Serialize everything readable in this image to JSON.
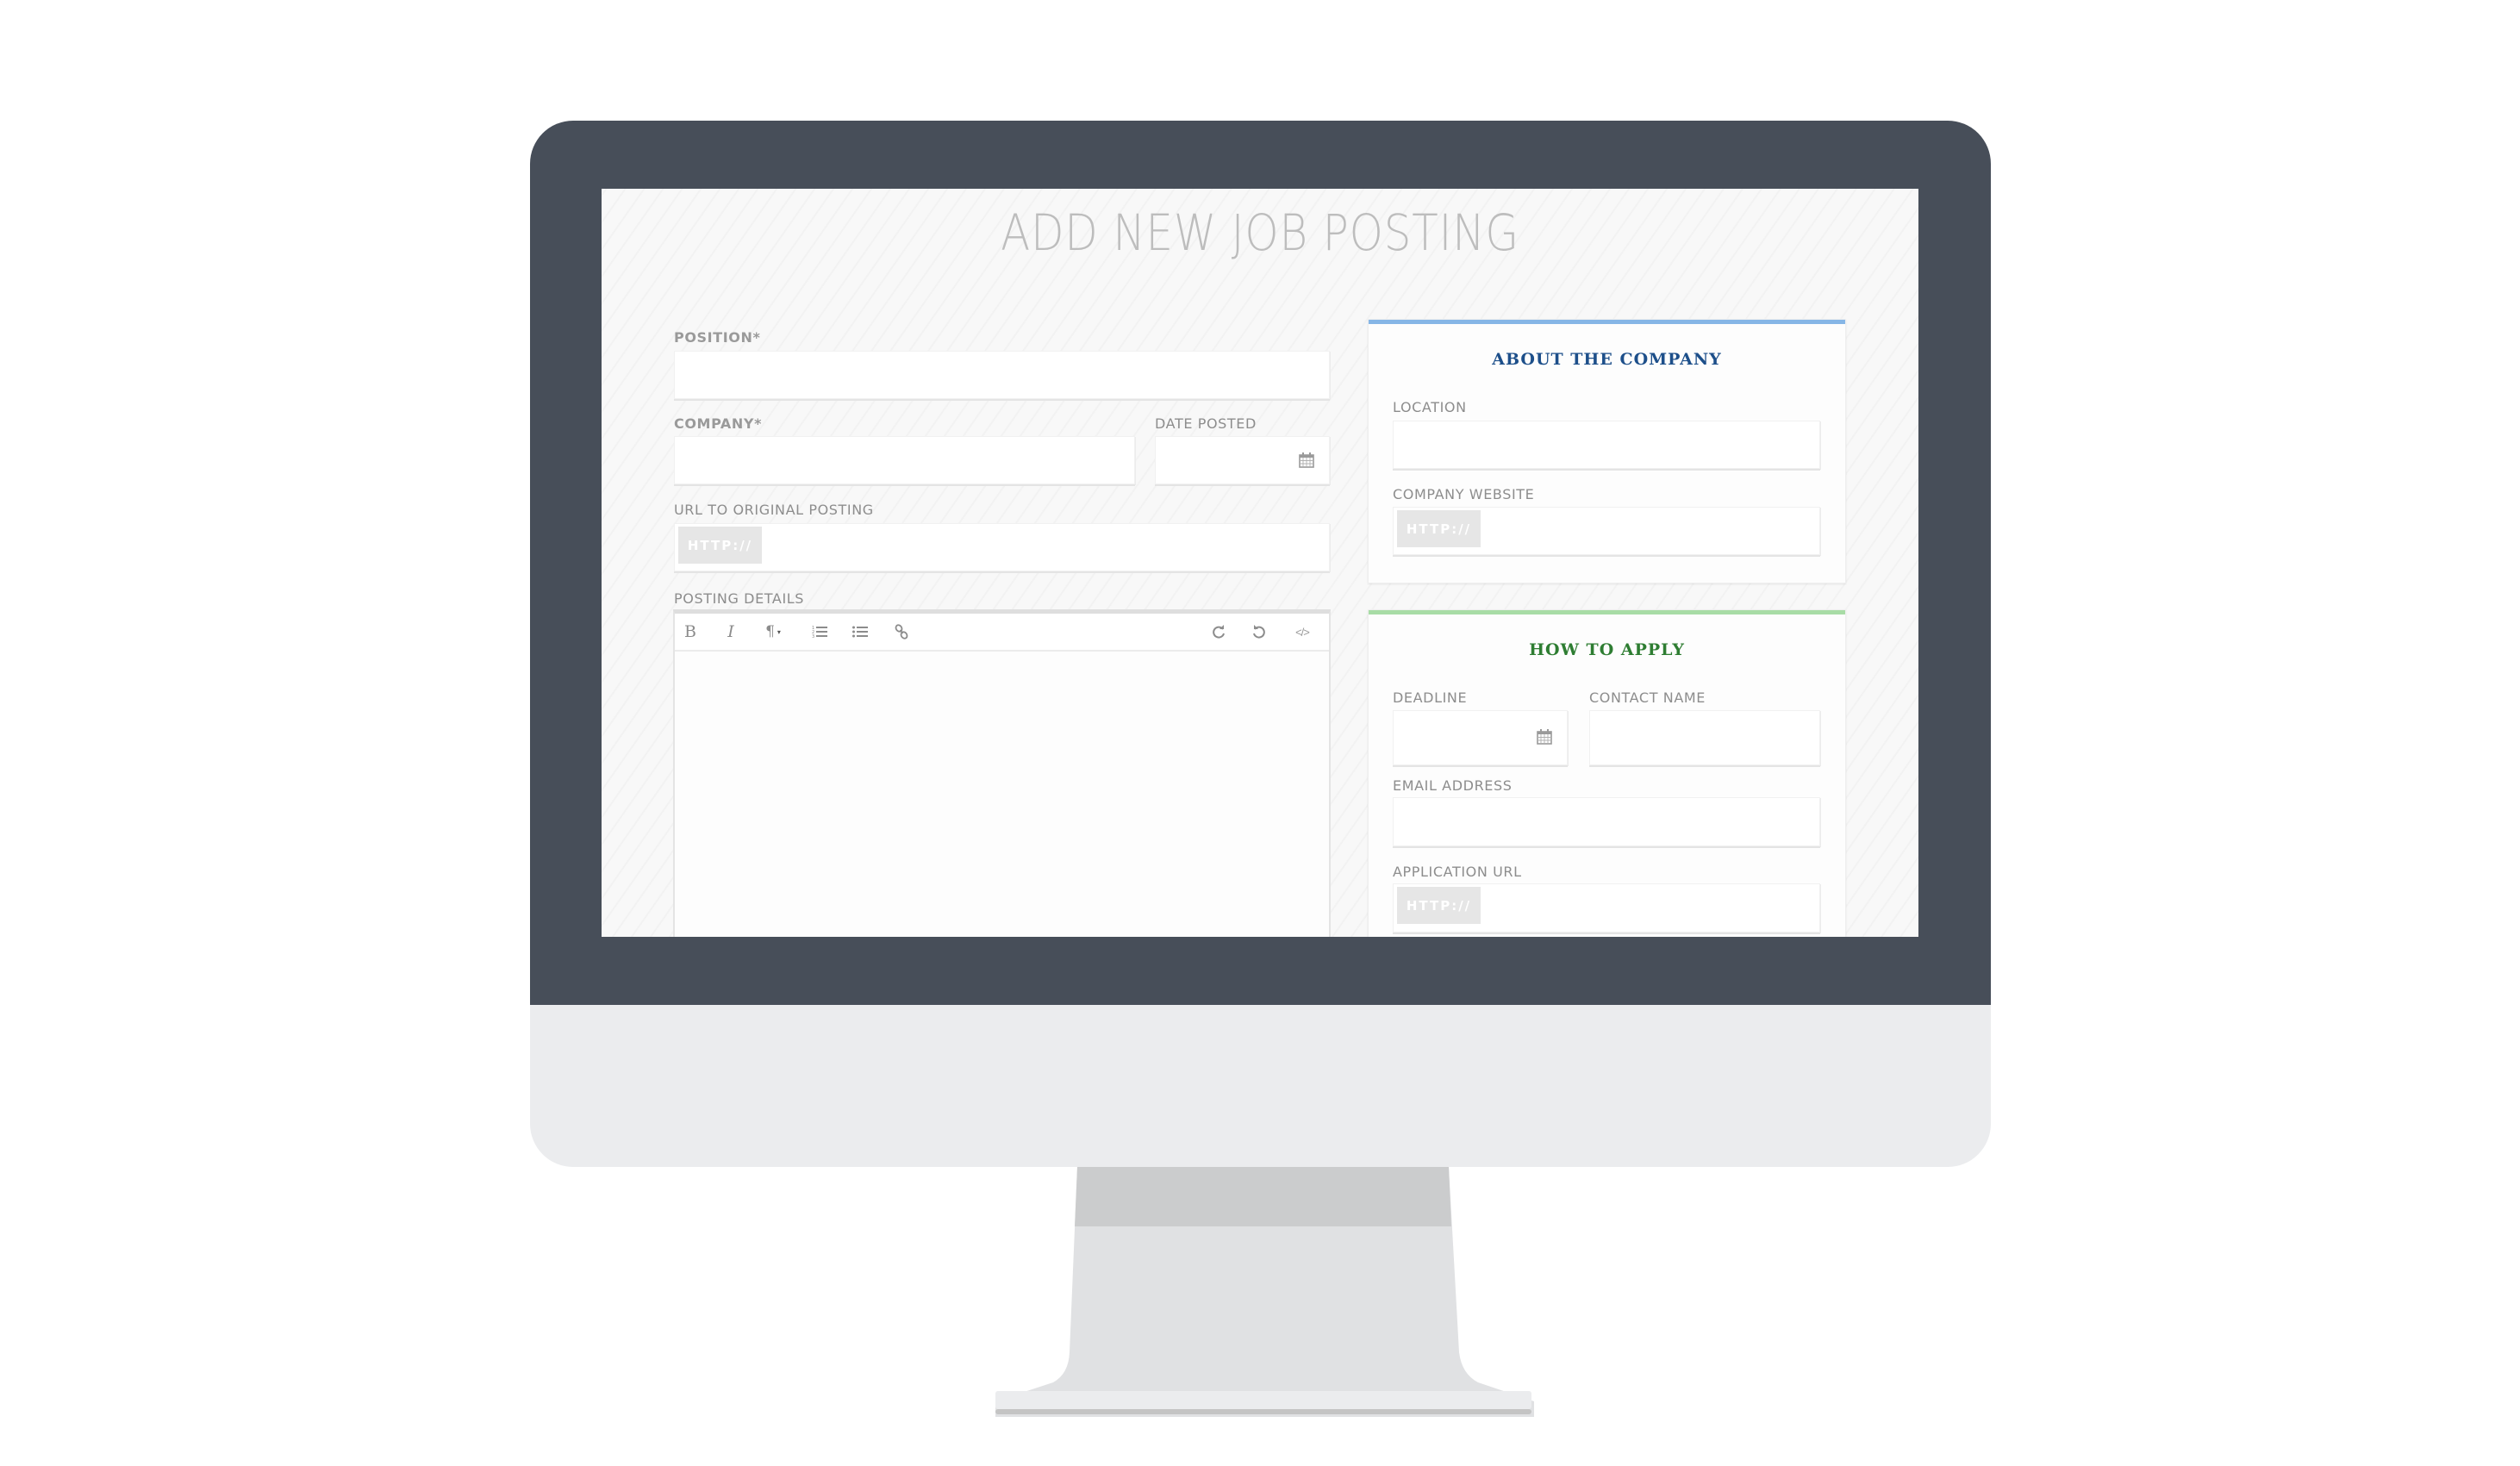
{
  "page": {
    "title": "ADD NEW JOB POSTING"
  },
  "form": {
    "position": {
      "label": "POSITION*",
      "value": ""
    },
    "company": {
      "label": "COMPANY*",
      "value": ""
    },
    "date_posted": {
      "label": "DATE POSTED",
      "value": "",
      "icon": "calendar-icon"
    },
    "url_original": {
      "label": "URL TO ORIGINAL POSTING",
      "prefix": "HTTP://",
      "value": ""
    },
    "posting_details": {
      "label": "POSTING DETAILS",
      "value": "",
      "toolbar": [
        {
          "name": "bold",
          "glyph": "B",
          "icon": "bold-icon"
        },
        {
          "name": "italic",
          "glyph": "I",
          "icon": "italic-icon"
        },
        {
          "name": "paragraph-format",
          "glyph": "¶",
          "icon": "paragraph-icon"
        },
        {
          "name": "ordered-list",
          "icon": "ordered-list-icon"
        },
        {
          "name": "unordered-list",
          "icon": "unordered-list-icon"
        },
        {
          "name": "link",
          "icon": "link-icon"
        },
        {
          "name": "redo",
          "icon": "redo-icon"
        },
        {
          "name": "undo",
          "icon": "undo-icon"
        },
        {
          "name": "code-view",
          "glyph": "</>",
          "icon": "code-icon"
        }
      ]
    }
  },
  "about_company": {
    "title": "ABOUT THE COMPANY",
    "accent_color": "#86b6e6",
    "title_color": "#1d4f8a",
    "location": {
      "label": "LOCATION",
      "value": ""
    },
    "website": {
      "label": "COMPANY WEBSITE",
      "prefix": "HTTP://",
      "value": ""
    }
  },
  "how_to_apply": {
    "title": "HOW TO APPLY",
    "accent_color": "#a8dca6",
    "title_color": "#2e7d32",
    "deadline": {
      "label": "DEADLINE",
      "value": "",
      "icon": "calendar-icon"
    },
    "contact_name": {
      "label": "CONTACT NAME",
      "value": ""
    },
    "email": {
      "label": "EMAIL ADDRESS",
      "value": ""
    },
    "application_url": {
      "label": "APPLICATION URL",
      "prefix": "HTTP://",
      "value": ""
    }
  },
  "theme": {
    "bezel_color": "#474e59",
    "chin_color": "#ebecee",
    "screen_bg": "#f8f8f8"
  }
}
